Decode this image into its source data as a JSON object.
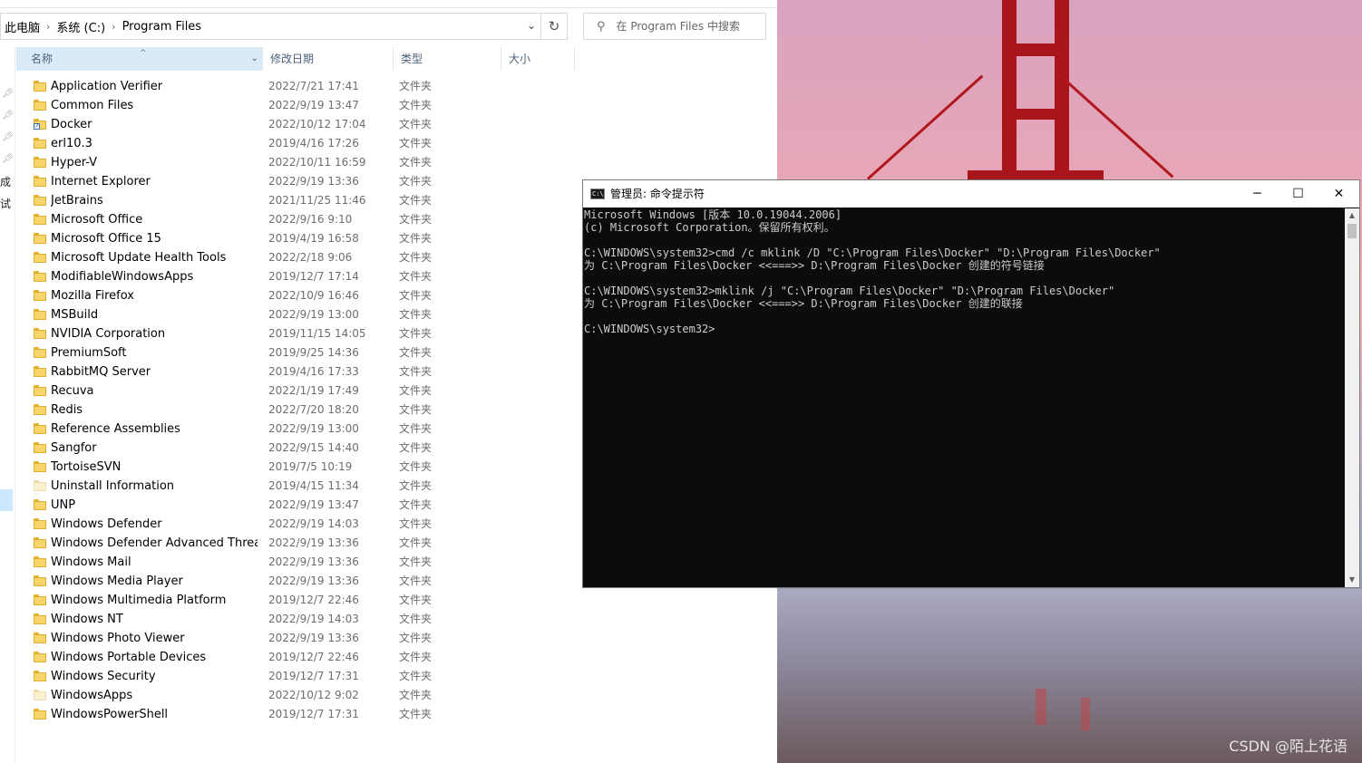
{
  "explorer": {
    "breadcrumb": [
      "此电脑",
      "系统 (C:)",
      "Program Files"
    ],
    "search_placeholder": "在 Program Files 中搜索",
    "columns": {
      "name": "名称",
      "modified": "修改日期",
      "type": "类型",
      "size": "大小"
    },
    "nav_fragments": [
      "成",
      "试"
    ],
    "files": [
      {
        "name": "Application Verifier",
        "modified": "2022/7/21 17:41",
        "type": "文件夹"
      },
      {
        "name": "Common Files",
        "modified": "2022/9/19 13:47",
        "type": "文件夹"
      },
      {
        "name": "Docker",
        "modified": "2022/10/12 17:04",
        "type": "文件夹",
        "shortcut": true
      },
      {
        "name": "erl10.3",
        "modified": "2019/4/16 17:26",
        "type": "文件夹"
      },
      {
        "name": "Hyper-V",
        "modified": "2022/10/11 16:59",
        "type": "文件夹"
      },
      {
        "name": "Internet Explorer",
        "modified": "2022/9/19 13:36",
        "type": "文件夹"
      },
      {
        "name": "JetBrains",
        "modified": "2021/11/25 11:46",
        "type": "文件夹"
      },
      {
        "name": "Microsoft Office",
        "modified": "2022/9/16 9:10",
        "type": "文件夹"
      },
      {
        "name": "Microsoft Office 15",
        "modified": "2019/4/19 16:58",
        "type": "文件夹"
      },
      {
        "name": "Microsoft Update Health Tools",
        "modified": "2022/2/18 9:06",
        "type": "文件夹"
      },
      {
        "name": "ModifiableWindowsApps",
        "modified": "2019/12/7 17:14",
        "type": "文件夹"
      },
      {
        "name": "Mozilla Firefox",
        "modified": "2022/10/9 16:46",
        "type": "文件夹"
      },
      {
        "name": "MSBuild",
        "modified": "2022/9/19 13:00",
        "type": "文件夹"
      },
      {
        "name": "NVIDIA Corporation",
        "modified": "2019/11/15 14:05",
        "type": "文件夹"
      },
      {
        "name": "PremiumSoft",
        "modified": "2019/9/25 14:36",
        "type": "文件夹"
      },
      {
        "name": "RabbitMQ Server",
        "modified": "2019/4/16 17:33",
        "type": "文件夹"
      },
      {
        "name": "Recuva",
        "modified": "2022/1/19 17:49",
        "type": "文件夹"
      },
      {
        "name": "Redis",
        "modified": "2022/7/20 18:20",
        "type": "文件夹"
      },
      {
        "name": "Reference Assemblies",
        "modified": "2022/9/19 13:00",
        "type": "文件夹"
      },
      {
        "name": "Sangfor",
        "modified": "2022/9/15 14:40",
        "type": "文件夹"
      },
      {
        "name": "TortoiseSVN",
        "modified": "2019/7/5 10:19",
        "type": "文件夹"
      },
      {
        "name": "Uninstall Information",
        "modified": "2019/4/15 11:34",
        "type": "文件夹",
        "pale": true
      },
      {
        "name": "UNP",
        "modified": "2022/9/19 13:47",
        "type": "文件夹"
      },
      {
        "name": "Windows Defender",
        "modified": "2022/9/19 14:03",
        "type": "文件夹"
      },
      {
        "name": "Windows Defender Advanced Threat ...",
        "modified": "2022/9/19 13:36",
        "type": "文件夹"
      },
      {
        "name": "Windows Mail",
        "modified": "2022/9/19 13:36",
        "type": "文件夹"
      },
      {
        "name": "Windows Media Player",
        "modified": "2022/9/19 13:36",
        "type": "文件夹"
      },
      {
        "name": "Windows Multimedia Platform",
        "modified": "2019/12/7 22:46",
        "type": "文件夹"
      },
      {
        "name": "Windows NT",
        "modified": "2022/9/19 14:03",
        "type": "文件夹"
      },
      {
        "name": "Windows Photo Viewer",
        "modified": "2022/9/19 13:36",
        "type": "文件夹"
      },
      {
        "name": "Windows Portable Devices",
        "modified": "2019/12/7 22:46",
        "type": "文件夹"
      },
      {
        "name": "Windows Security",
        "modified": "2019/12/7 17:31",
        "type": "文件夹"
      },
      {
        "name": "WindowsApps",
        "modified": "2022/10/12 9:02",
        "type": "文件夹",
        "pale": true
      },
      {
        "name": "WindowsPowerShell",
        "modified": "2019/12/7 17:31",
        "type": "文件夹"
      }
    ]
  },
  "console": {
    "title": "管理员: 命令提示符",
    "icon_text": "C:\\",
    "lines": [
      "Microsoft Windows [版本 10.0.19044.2006]",
      "(c) Microsoft Corporation。保留所有权利。",
      "",
      "C:\\WINDOWS\\system32>cmd /c mklink /D \"C:\\Program Files\\Docker\" \"D:\\Program Files\\Docker\"",
      "为 C:\\Program Files\\Docker <<===>> D:\\Program Files\\Docker 创建的符号链接",
      "",
      "C:\\WINDOWS\\system32>mklink /j \"C:\\Program Files\\Docker\" \"D:\\Program Files\\Docker\"",
      "为 C:\\Program Files\\Docker <<===>> D:\\Program Files\\Docker 创建的联接",
      "",
      "C:\\WINDOWS\\system32>"
    ]
  },
  "desktop": {
    "watermark": "CSDN @陌上花语"
  }
}
